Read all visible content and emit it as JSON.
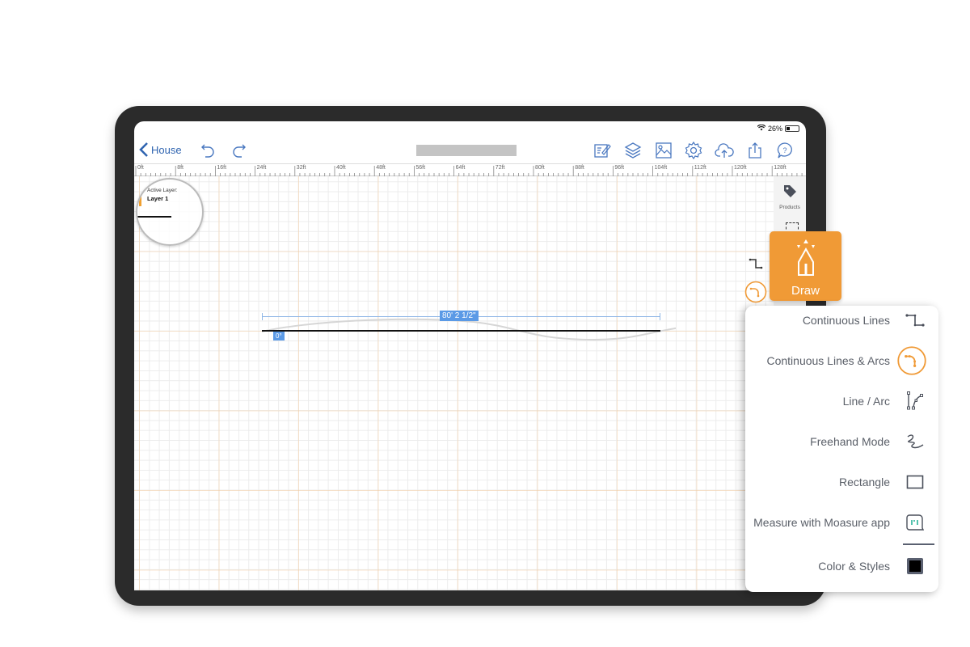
{
  "status_bar": {
    "battery": "26%"
  },
  "toolbar": {
    "back_label": "House",
    "icons": [
      "undo-icon",
      "redo-icon",
      "edit-notes-icon",
      "layers-icon",
      "image-icon",
      "settings-gear-icon",
      "cloud-upload-icon",
      "share-icon",
      "help-icon"
    ]
  },
  "ruler": {
    "labels": [
      "0ft",
      "8ft",
      "16ft",
      "24ft",
      "32ft",
      "40ft",
      "48ft",
      "56ft",
      "64ft",
      "72ft",
      "80ft",
      "88ft",
      "96ft",
      "104ft",
      "112ft",
      "120ft",
      "128ft"
    ]
  },
  "magnifier": {
    "active_layer_label": "Active Layer:",
    "layer_name": "Layer 1"
  },
  "side_panel": {
    "products_label": "Products"
  },
  "canvas": {
    "dimension_label": "80' 2 1/2\"",
    "angle_label": "0°"
  },
  "draw_button": {
    "label": "Draw",
    "color": "#f09a36"
  },
  "draw_menu": {
    "items": [
      {
        "label": "Continuous Lines",
        "icon": "continuous-lines-icon"
      },
      {
        "label": "Continuous Lines & Arcs",
        "icon": "continuous-lines-arcs-icon",
        "selected": true
      },
      {
        "label": "Line / Arc",
        "icon": "line-arc-icon"
      },
      {
        "label": "Freehand Mode",
        "icon": "freehand-icon"
      },
      {
        "label": "Rectangle",
        "icon": "rectangle-icon"
      },
      {
        "label": "Measure with Moasure app",
        "icon": "moasure-icon"
      },
      {
        "label": "Color & Styles",
        "icon": "color-styles-icon"
      }
    ]
  },
  "colors": {
    "accent": "#f09a36",
    "toolbar_blue": "#2f64b0",
    "dimension_blue": "#5b9ae6"
  }
}
